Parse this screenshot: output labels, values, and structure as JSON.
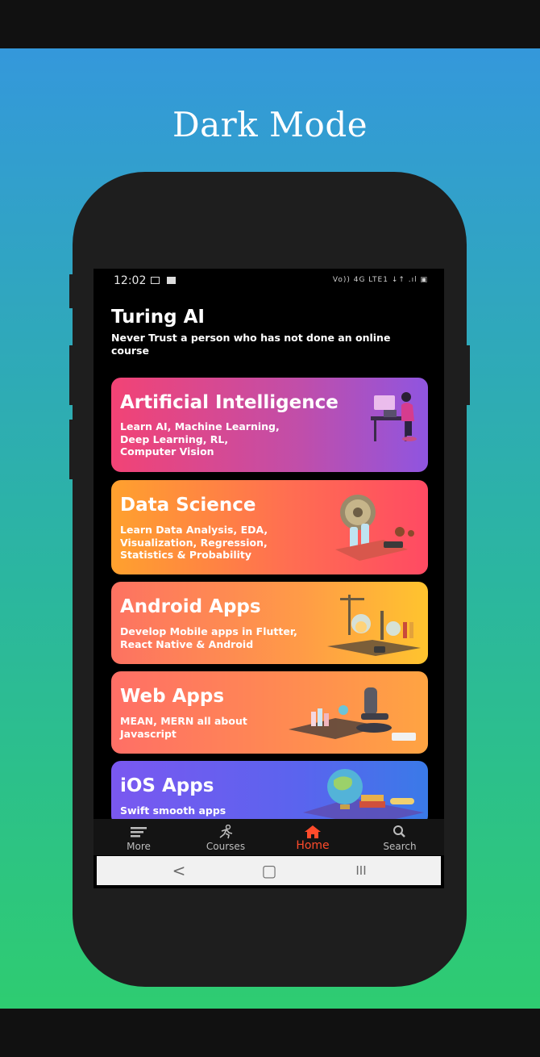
{
  "promo": {
    "title": "Dark Mode"
  },
  "status_bar": {
    "time": "12:02",
    "right_text": "Vo)) 4G LTE1 ↓↑ .ıl ▣"
  },
  "app": {
    "title": "Turing AI",
    "subtitle": "Never Trust a person who has not done an online course"
  },
  "cards": [
    {
      "title": "Artificial Intelligence",
      "desc": "Learn AI, Machine Learning, Deep Learning, RL, Computer Vision",
      "icon": "person-at-desk-illustration"
    },
    {
      "title": "Data Science",
      "desc": "Learn Data Analysis, EDA, Visualization, Regression, Statistics & Probability",
      "icon": "science-lab-illustration"
    },
    {
      "title": "Android Apps",
      "desc": "Develop Mobile apps in Flutter, React Native & Android",
      "icon": "chemistry-apparatus-illustration"
    },
    {
      "title": "Web Apps",
      "desc": "MEAN, MERN all about Javascript",
      "icon": "microscope-illustration"
    },
    {
      "title": "iOS Apps",
      "desc": "Swift smooth apps",
      "icon": "globe-books-illustration"
    }
  ],
  "bottom_nav": {
    "items": [
      {
        "label": "More",
        "icon": "menu-lines-icon"
      },
      {
        "label": "Courses",
        "icon": "runner-icon"
      },
      {
        "label": "Home",
        "icon": "home-icon",
        "active": true
      },
      {
        "label": "Search",
        "icon": "search-icon"
      }
    ]
  },
  "system_nav": {
    "back": "<",
    "home": "▢",
    "recents": "III"
  },
  "colors": {
    "active_nav": "#ff4b2b",
    "background_top": "#3498db",
    "background_bottom": "#2ecc71"
  }
}
